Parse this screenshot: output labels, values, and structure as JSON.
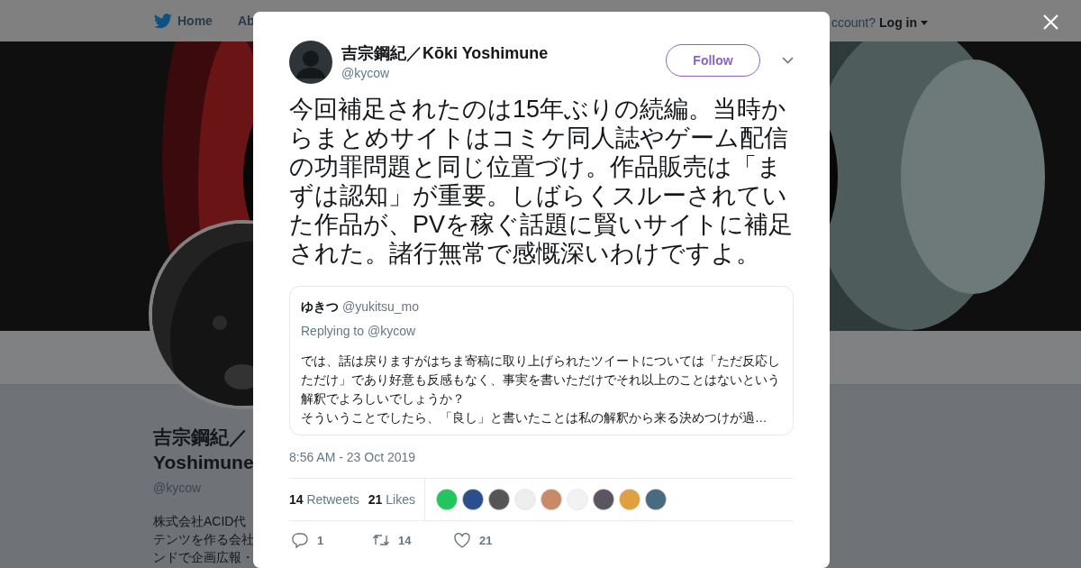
{
  "background_page": {
    "nav": {
      "home": "Home",
      "about": "Ab",
      "account_prompt": "ccount?",
      "login": "Log in"
    },
    "profile": {
      "name_line_1": "吉宗鋼紀／",
      "name_line_2": "Yoshimune",
      "handle": "@kycow",
      "bio_lines": [
        "株式会社ACID代",
        "テンツを作る会社",
        "ンドで企画広報・"
      ]
    }
  },
  "tweet": {
    "author": {
      "name": "吉宗鋼紀／Kōki Yoshimune",
      "handle": "@kycow"
    },
    "follow_button": "Follow",
    "text": "今回補足されたのは15年ぶりの続編。当時からまとめサイトはコミケ同人誌やゲーム配信の功罪問題と同じ位置づけ。作品販売は「まずは認知」が重要。しばらくスルーされていた作品が、PVを稼ぐ話題に賢いサイトに補足された。諸行無常で感慨深いわけですよ。",
    "quoted": {
      "name": "ゆきつ",
      "handle": "@yukitsu_mo",
      "replying_to": "Replying to @kycow",
      "text_lines": [
        "では、話は戻りますがはちま寄稿に取り上げられたツイートについては「ただ反応しただけ」であり好意も反感もなく、事実を書いただけでそれ以上のことはないという解釈でよろしいでしょうか？",
        "そういうことでしたら、「良し」と書いたことは私の解釈から来る決めつけが過…"
      ]
    },
    "timestamp": "8:56 AM - 23 Oct 2019",
    "stats": [
      {
        "count": "14",
        "label": "Retweets"
      },
      {
        "count": "21",
        "label": "Likes"
      }
    ],
    "likers": [
      {
        "color": "#22c55e"
      },
      {
        "color": "#2b4f8a"
      },
      {
        "color": "#555555"
      },
      {
        "color": "#eeeeee"
      },
      {
        "color": "#c98a6a"
      },
      {
        "color": "#f2f2f2"
      },
      {
        "color": "#5a5560"
      },
      {
        "color": "#e0a040"
      },
      {
        "color": "#4a6a80"
      }
    ],
    "actions": [
      {
        "kind": "reply",
        "count": "1"
      },
      {
        "kind": "retweet",
        "count": "14"
      },
      {
        "kind": "like",
        "count": "21"
      }
    ]
  }
}
